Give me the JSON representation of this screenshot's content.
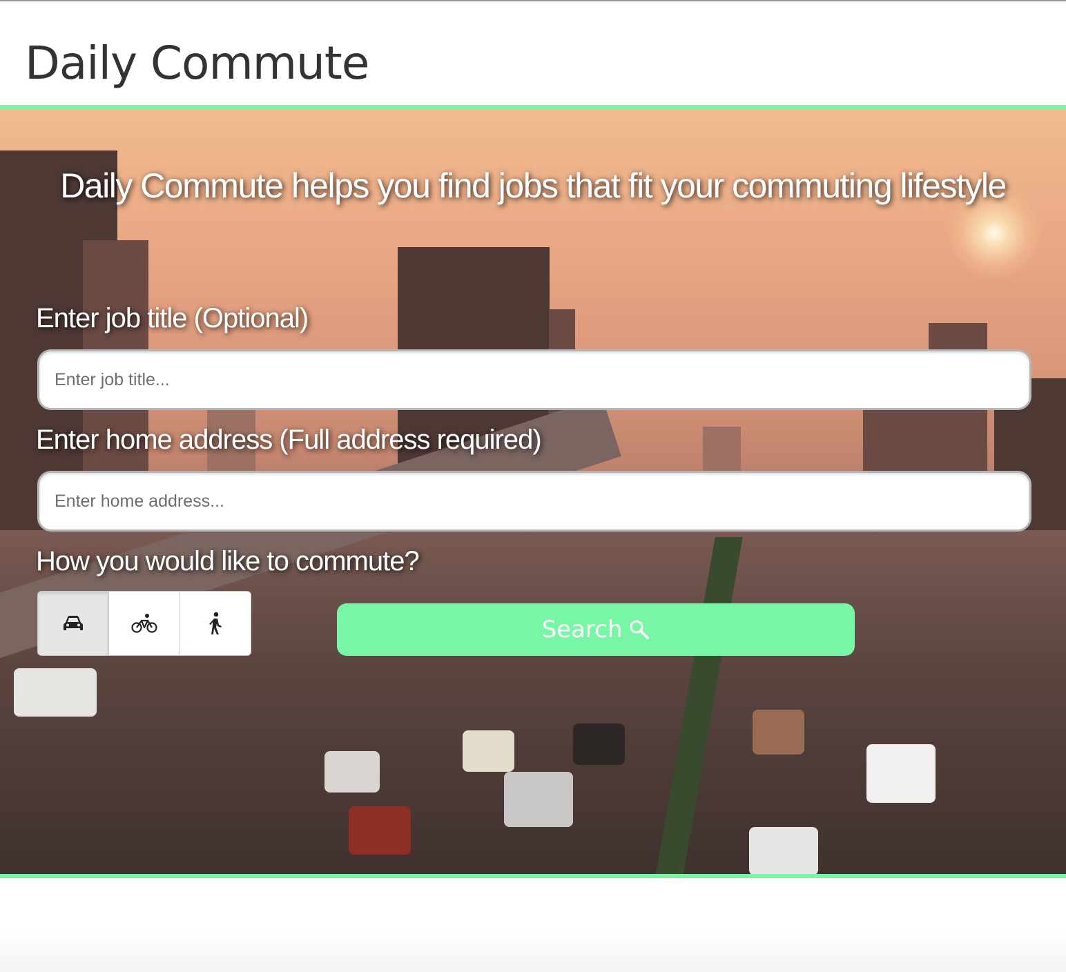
{
  "header": {
    "title": "Daily Commute"
  },
  "hero": {
    "headline": "Daily Commute helps you find jobs that fit your commuting lifestyle"
  },
  "form": {
    "job_title_label": "Enter job title (Optional)",
    "job_title_placeholder": "Enter job title...",
    "job_title_value": "",
    "home_address_label": "Enter home address (Full address required)",
    "home_address_placeholder": "Enter home address...",
    "home_address_value": "",
    "commute_label": "How you would like to commute?",
    "commute_modes": [
      {
        "icon": "car-icon",
        "selected": true
      },
      {
        "icon": "bicycle-icon",
        "selected": false
      },
      {
        "icon": "walking-icon",
        "selected": false
      }
    ],
    "search_label": "Search",
    "search_icon": "search-icon"
  },
  "colors": {
    "accent": "#77f7a6",
    "title_text": "#333333",
    "hero_text": "#ffffff"
  }
}
